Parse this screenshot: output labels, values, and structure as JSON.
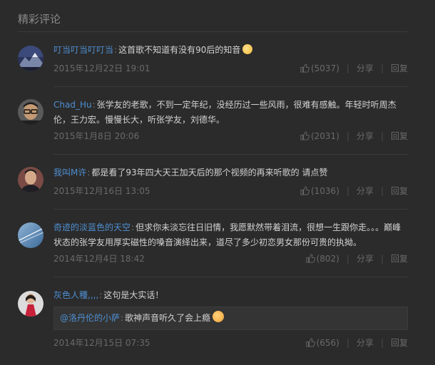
{
  "section_title": "精彩评论",
  "separator": "|",
  "colon": ":",
  "actions": {
    "share": "分享",
    "reply": "回复"
  },
  "comments": [
    {
      "user": "叮当叮当叮叮当",
      "text": "这首歌不知道有没有90后的知音",
      "emoji": "sweat-smile-emoji",
      "date": "2015年12月22日 19:01",
      "likes": "(5037)"
    },
    {
      "user": "Chad_Hu",
      "text": "张学友的老歌，不到一定年纪，没经历过一些风雨，很难有感触。年轻时听周杰伦，王力宏。慢慢长大，听张学友，刘德华。",
      "date": "2015年1月8日 20:06",
      "likes": "(2031)"
    },
    {
      "user": "我叫M许",
      "text": "都是看了93年四大天王加天后的那个视频的再来听歌的 请点赞",
      "date": "2015年12月16日 13:05",
      "likes": "(1036)"
    },
    {
      "user": "奇迹的淡蓝色的天空",
      "text": "但求你未淡忘往日旧情，我愿默然带着泪流，很想一生跟你走。。。巅峰状态的张学友用厚实磁性的嗓音演绎出来，道尽了多少初恋男女那份可贵的执拗。",
      "date": "2014年12月4日 18:42",
      "likes": "(802)"
    },
    {
      "user": "灰色人種,,,,",
      "text": "这句是大实话！",
      "quoted_user": "@洛丹伦的小萨",
      "quoted_text": "歌神声音听久了会上瘾",
      "quoted_emoji": "kiss-emoji",
      "date": "2014年12月15日 07:35",
      "likes": "(656)"
    }
  ]
}
